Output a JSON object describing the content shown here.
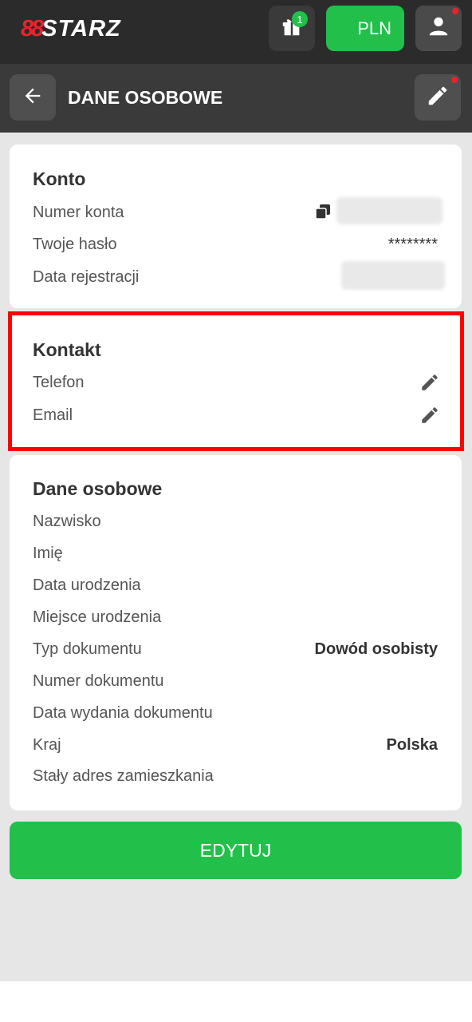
{
  "header": {
    "logo_mark": "88",
    "logo_text": "STARZ",
    "gift_badge": "1",
    "currency": "PLN"
  },
  "subheader": {
    "title": "DANE OSOBOWE"
  },
  "konto": {
    "title": "Konto",
    "rows": [
      {
        "label": "Numer konta"
      },
      {
        "label": "Twoje hasło",
        "value": "********"
      },
      {
        "label": "Data rejestracji"
      }
    ]
  },
  "kontakt": {
    "title": "Kontakt",
    "rows": [
      {
        "label": "Telefon"
      },
      {
        "label": "Email"
      }
    ]
  },
  "dane": {
    "title": "Dane osobowe",
    "rows": [
      {
        "label": "Nazwisko"
      },
      {
        "label": "Imię"
      },
      {
        "label": "Data urodzenia"
      },
      {
        "label": "Miejsce urodzenia"
      },
      {
        "label": "Typ dokumentu",
        "value": "Dowód osobisty"
      },
      {
        "label": "Numer dokumentu"
      },
      {
        "label": "Data wydania dokumentu"
      },
      {
        "label": "Kraj",
        "value": "Polska"
      },
      {
        "label": "Stały adres zamieszkania"
      }
    ]
  },
  "edit_button": "EDYTUJ",
  "icons": {
    "gift": "gift-icon",
    "user": "user-icon",
    "back": "arrow-left-icon",
    "edit": "pencil-icon",
    "copy": "copy-icon"
  },
  "colors": {
    "green": "#22c04b",
    "red": "#e8242b",
    "topbar": "#2b2b2b",
    "subbar": "#3a3a3a",
    "highlight": "#ff0000"
  }
}
